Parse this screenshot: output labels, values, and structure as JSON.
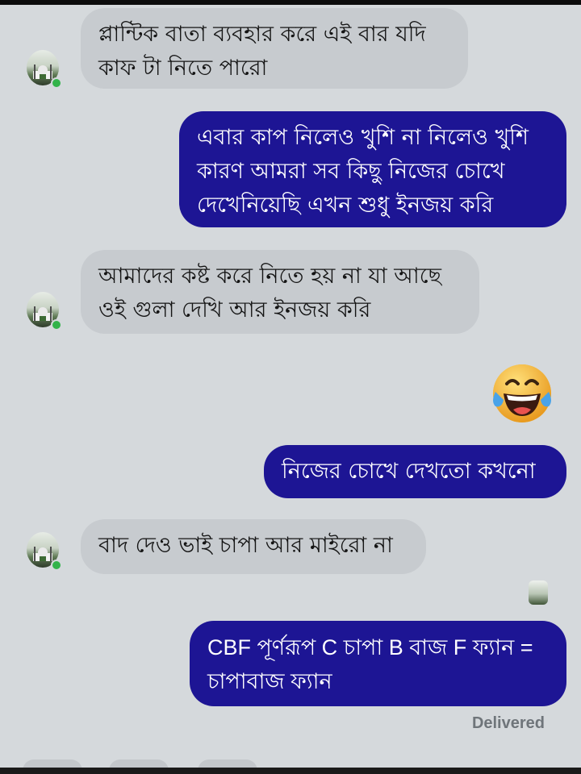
{
  "messages": [
    {
      "direction": "incoming",
      "text": "প্লান্টিক বাতা ব্যবহার করে এই বার যদি\nকাফ টা নিতে পারো"
    },
    {
      "direction": "outgoing",
      "text": "এবার কাপ নিলেও খুশি না নিলেও খুশি\nকারণ আমরা সব কিছু নিজের চোখে\nদেখেনিয়েছি এখন শুধু ইনজয় করি"
    },
    {
      "direction": "incoming",
      "text": "আমাদের কষ্ট করে নিতে হয় না যা আছে\nওই গুলা দেখি আর ইনজয় করি"
    },
    {
      "direction": "outgoing",
      "type": "emoji",
      "emoji": "😂",
      "icon": "laughing-tears-emoji"
    },
    {
      "direction": "outgoing",
      "text": "নিজের চোখে দেখতো কখনো"
    },
    {
      "direction": "incoming",
      "text": "বাদ দেও ভাই চাপা আর মাইরো না"
    },
    {
      "direction": "outgoing",
      "text": "CBF পূর্ণরূপ C চাপা B বাজ F ফ্যান =\nচাপাবাজ ফ্যান"
    }
  ],
  "status": "Delivered",
  "colors": {
    "background": "#d5d9dc",
    "incoming_bubble": "#c7cbcf",
    "outgoing_bubble": "#1d1594",
    "online": "#32b34a"
  }
}
